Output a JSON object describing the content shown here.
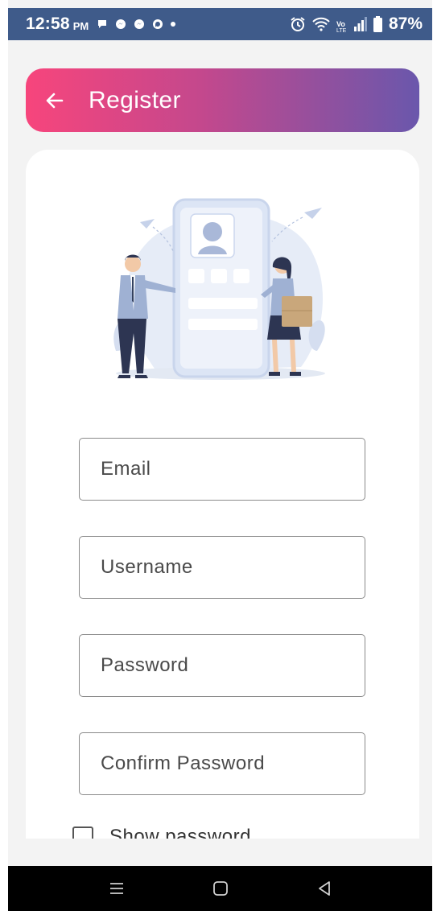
{
  "status_bar": {
    "time": "12:58",
    "ampm": "PM",
    "battery": "87%",
    "icons": [
      "chat-bubble-icon",
      "messenger-icon",
      "messenger-icon",
      "messenger-icon",
      "notification-dot-icon",
      "alarm-icon",
      "wifi-icon",
      "lte-icon",
      "signal-icon",
      "battery-icon"
    ]
  },
  "header": {
    "title": "Register",
    "back_icon": "arrow-left-icon",
    "gradient": [
      "#f7457c",
      "#6a57ac"
    ]
  },
  "form": {
    "email_placeholder": "Email",
    "username_placeholder": "Username",
    "password_placeholder": "Password",
    "confirm_password_placeholder": "Confirm Password",
    "show_password_label": "Show password"
  },
  "illustration": {
    "icon": "registration-illustration"
  },
  "nav": {
    "icons": [
      "recents-icon",
      "home-icon",
      "back-icon"
    ]
  }
}
